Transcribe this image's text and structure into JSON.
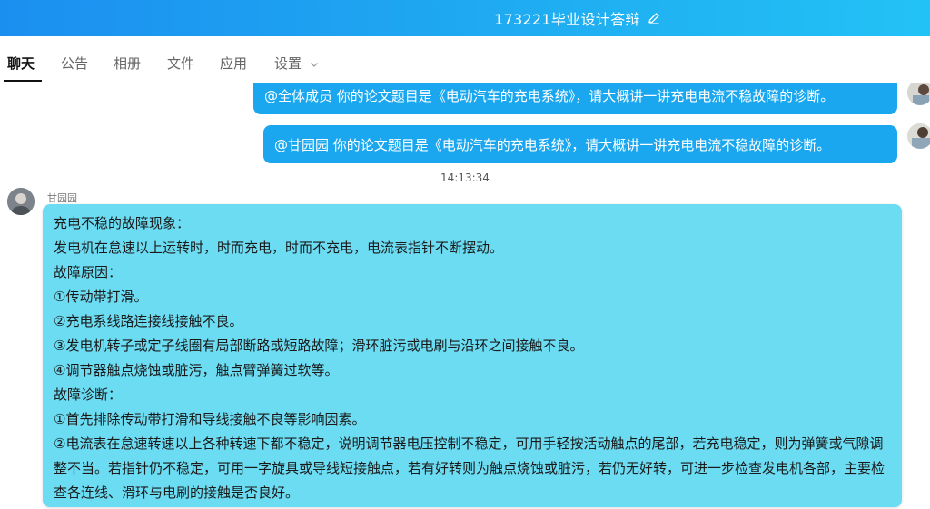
{
  "window": {
    "title": "173221毕业设计答辩",
    "edit_icon": "pencil-icon"
  },
  "tabs": [
    {
      "label": "聊天",
      "active": true
    },
    {
      "label": "公告",
      "active": false
    },
    {
      "label": "相册",
      "active": false
    },
    {
      "label": "文件",
      "active": false
    },
    {
      "label": "应用",
      "active": false
    },
    {
      "label": "设置",
      "active": false,
      "has_dropdown": true
    }
  ],
  "messages_out": [
    {
      "text": "@全体成员 你的论文题目是《电动汽车的充电系统》，请大概讲一讲充电电流不稳故障的诊断。"
    },
    {
      "text": "@甘园园  你的论文题目是《电动汽车的充电系统》，请大概讲一讲充电电流不稳故障的诊断。"
    }
  ],
  "timestamp": "14:13:34",
  "message_in": {
    "sender": "甘园园",
    "lines": [
      "充电不稳的故障现象：",
      "发电机在怠速以上运转时，时而充电，时而不充电，电流表指针不断摆动。",
      "故障原因：",
      "①传动带打滑。",
      "②充电系线路连接线接触不良。",
      "③发电机转子或定子线圈有局部断路或短路故障；滑环脏污或电刷与沿环之间接触不良。",
      "④调节器触点烧蚀或脏污，触点臂弹簧过软等。",
      "故障诊断：",
      "①首先排除传动带打滑和导线接触不良等影响因素。",
      "②电流表在怠速转速以上各种转速下都不稳定，说明调节器电压控制不稳定，可用手轻按活动触点的尾部，若充电稳定，则为弹簧或气隙调整不当。若指针仍不稳定，可用一字旋具或导线短接触点，若有好转则为触点烧蚀或脏污，若仍无好转，可进一步检查发电机各部，主要检查各连线、滑环与电刷的接触是否良好。"
    ]
  },
  "colors": {
    "titlebar": "#1b8ff0",
    "outgoing_bubble": "#1aa7ef",
    "incoming_bubble": "#6cdcf3"
  }
}
